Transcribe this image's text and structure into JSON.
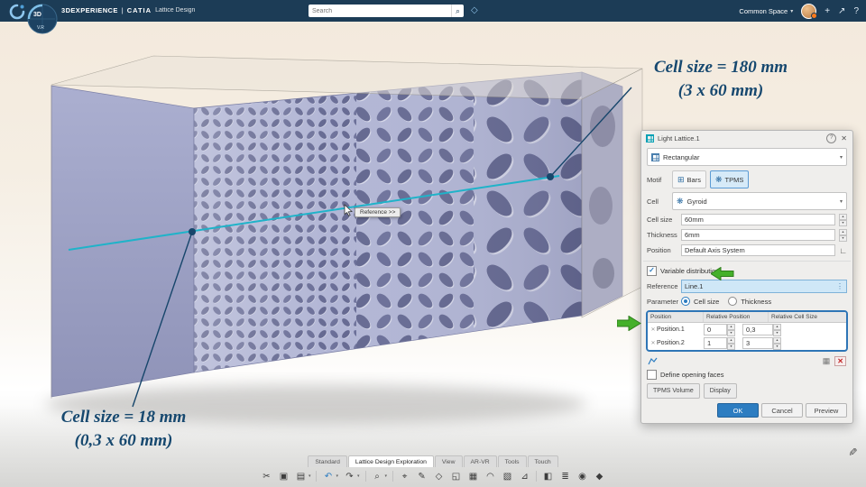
{
  "top_bar": {
    "brand": "3DEXPERIENCE",
    "divider": "|",
    "app": "CATIA",
    "subtitle": "Lattice Design",
    "search_placeholder": "Search",
    "space_label": "Common Space"
  },
  "compass": {
    "label": "3D",
    "sub_label": "V.R"
  },
  "viewport": {
    "annotation_top_line1": "Cell size = 180 mm",
    "annotation_top_line2": "(3 x 60 mm)",
    "annotation_bottom_line1": "Cell size = 18 mm",
    "annotation_bottom_line2": "(0,3 x 60 mm)",
    "tooltip": "Reference >>"
  },
  "dialog": {
    "title": "Light Lattice.1",
    "pattern_type": "Rectangular",
    "motif_label": "Motif",
    "motif_bars": "Bars",
    "motif_tpms": "TPMS",
    "cell_label": "Cell",
    "cell_value": "Gyroid",
    "cell_size_label": "Cell size",
    "cell_size_value": "60mm",
    "thickness_label": "Thickness",
    "thickness_value": "6mm",
    "position_label": "Position",
    "position_value": "Default Axis System",
    "variable_distribution_label": "Variable distribution",
    "variable_distribution_checked": "✓",
    "reference_label": "Reference",
    "reference_value": "Line.1",
    "parameter_label": "Parameter",
    "parameter_cell_size": "Cell size",
    "parameter_thickness": "Thickness",
    "table": {
      "headers": [
        "Position",
        "Relative Position",
        "Relative Cell Size"
      ],
      "rows": [
        {
          "position": "Position.1",
          "relative_position": "0",
          "relative_cell_size": "0,3"
        },
        {
          "position": "Position.2",
          "relative_position": "1",
          "relative_cell_size": "3"
        }
      ]
    },
    "define_opening_faces_label": "Define opening faces",
    "tpms_volume_button": "TPMS Volume",
    "display_button": "Display",
    "ok_button": "OK",
    "cancel_button": "Cancel",
    "preview_button": "Preview"
  },
  "tabs": [
    "Standard",
    "Lattice Design Exploration",
    "View",
    "AR-VR",
    "Tools",
    "Touch"
  ],
  "icons": {
    "chevron": "▾",
    "search": "⌕",
    "tag": "◇",
    "plus": "+",
    "share": "↗",
    "close": "✕",
    "help": "?",
    "cut": "✂",
    "copy": "▣",
    "paste": "▤",
    "undo": "↶",
    "redo": "↷",
    "zoom": "⌕",
    "axis": "⌖",
    "sketch": "✎",
    "plane": "◇",
    "extrude": "◱",
    "lattice": "▦",
    "fillet": "◠",
    "pattern": "▧",
    "measure": "⊿",
    "section": "◧",
    "layers": "≣",
    "display": "◉",
    "iso": "◆",
    "pencil": "✎",
    "gyroid": "❋",
    "bars_motif": "⊞",
    "row_delete": "✕",
    "table_grid": "▦",
    "clear_red_x": "✕",
    "axis_target": "∟",
    "reference_picker": "⋮"
  },
  "colors": {
    "topbar": "#1c3c56",
    "accent_blue": "#2d7dc1",
    "teal_line": "#1fb3c9",
    "annotation_blue": "#16486f",
    "green_arrow": "#44b02a"
  }
}
